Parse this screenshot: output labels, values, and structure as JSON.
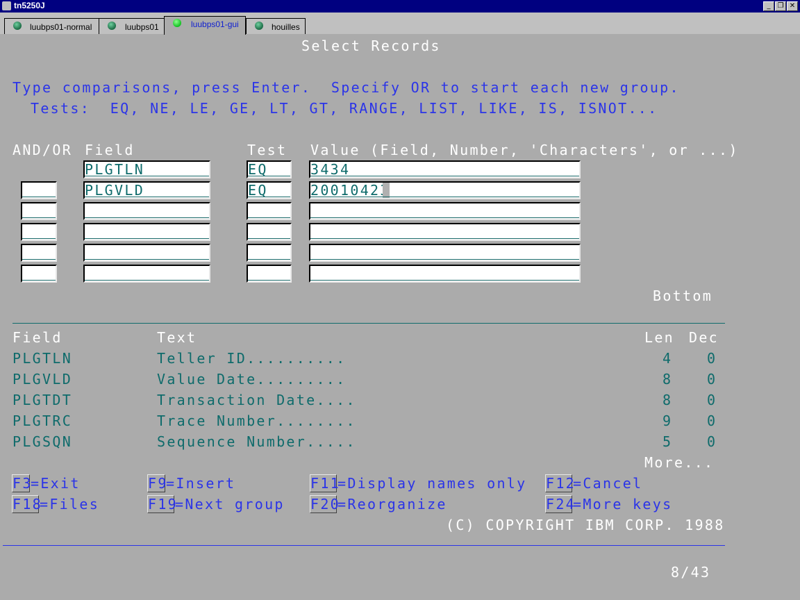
{
  "window": {
    "title": "tn5250J"
  },
  "tabs": [
    {
      "label": "luubps01-normal"
    },
    {
      "label": "luubps01"
    },
    {
      "label": "luubps01-gui"
    },
    {
      "label": "houilles"
    }
  ],
  "screen": {
    "title": "Select Records",
    "instruction": "Type comparisons, press Enter.  Specify OR to start each new group.",
    "tests_line": "Tests:  EQ, NE, LE, GE, LT, GT, RANGE, LIST, LIKE, IS, ISNOT...",
    "headers": {
      "andor": "AND/OR",
      "field": "Field",
      "test": "Test",
      "value": "Value (Field, Number, 'Characters', or ...)"
    },
    "rows": [
      {
        "andor": "",
        "field": "PLGTLN",
        "test": "EQ",
        "value": "3434"
      },
      {
        "andor": "",
        "field": "PLGVLD",
        "test": "EQ",
        "value": "20010423"
      },
      {
        "andor": "",
        "field": "",
        "test": "",
        "value": ""
      },
      {
        "andor": "",
        "field": "",
        "test": "",
        "value": ""
      },
      {
        "andor": "",
        "field": "",
        "test": "",
        "value": ""
      },
      {
        "andor": "",
        "field": "",
        "test": "",
        "value": ""
      }
    ],
    "bottom_label": "Bottom",
    "list_headers": {
      "field": "Field",
      "text": "Text",
      "len": "Len",
      "dec": "Dec"
    },
    "list": [
      {
        "field": "PLGTLN",
        "text": "Teller ID..........",
        "len": "4",
        "dec": "0"
      },
      {
        "field": "PLGVLD",
        "text": "Value Date.........",
        "len": "8",
        "dec": "0"
      },
      {
        "field": "PLGTDT",
        "text": "Transaction Date....",
        "len": "8",
        "dec": "0"
      },
      {
        "field": "PLGTRC",
        "text": "Trace Number........",
        "len": "9",
        "dec": "0"
      },
      {
        "field": "PLGSQN",
        "text": "Sequence Number.....",
        "len": "5",
        "dec": "0"
      }
    ],
    "more_label": "More...",
    "fkeys": [
      {
        "key": "F3",
        "desc": "=Exit"
      },
      {
        "key": "F9",
        "desc": "=Insert"
      },
      {
        "key": "F11",
        "desc": "=Display names only"
      },
      {
        "key": "F12",
        "desc": "=Cancel"
      },
      {
        "key": "F18",
        "desc": "=Files"
      },
      {
        "key": "F19",
        "desc": "=Next group"
      },
      {
        "key": "F20",
        "desc": "=Reorganize"
      },
      {
        "key": "F24",
        "desc": "=More keys"
      }
    ],
    "copyright": "(C) COPYRIGHT IBM CORP. 1988",
    "status_position": "8/43"
  },
  "colors": {
    "title_bar": "#000080",
    "field_blue": "#2b34e8",
    "teal": "#0e6b6b",
    "background": "#ababab"
  }
}
